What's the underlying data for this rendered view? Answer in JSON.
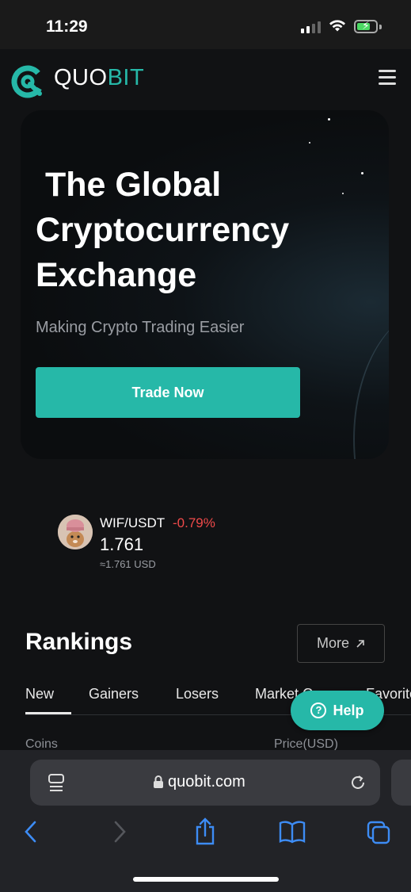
{
  "status_bar": {
    "time": "11:29"
  },
  "header": {
    "brand_part1": "QUO",
    "brand_part2": "BIT",
    "menu_icon": "hamburger-menu-icon"
  },
  "hero": {
    "title_line1": "The Global",
    "title_line2": "Cryptocurrency",
    "title_line3": "Exchange",
    "subtitle": "Making Crypto Trading Easier",
    "cta_label": "Trade Now"
  },
  "ticker": {
    "pair": "WIF/USDT",
    "change": "-0.79%",
    "price": "1.761",
    "usd": "≈1.761 USD"
  },
  "rankings": {
    "title": "Rankings",
    "more_label": "More",
    "tabs": [
      "New",
      "Gainers",
      "Losers",
      "Market Cap",
      "Favorites"
    ],
    "active_tab": "New",
    "columns": [
      "Coins",
      "Price(USD)"
    ]
  },
  "help": {
    "label": "Help"
  },
  "browser": {
    "url": "quobit.com"
  },
  "colors": {
    "accent": "#26b8a8",
    "negative": "#f04a4a",
    "background": "#111214"
  }
}
